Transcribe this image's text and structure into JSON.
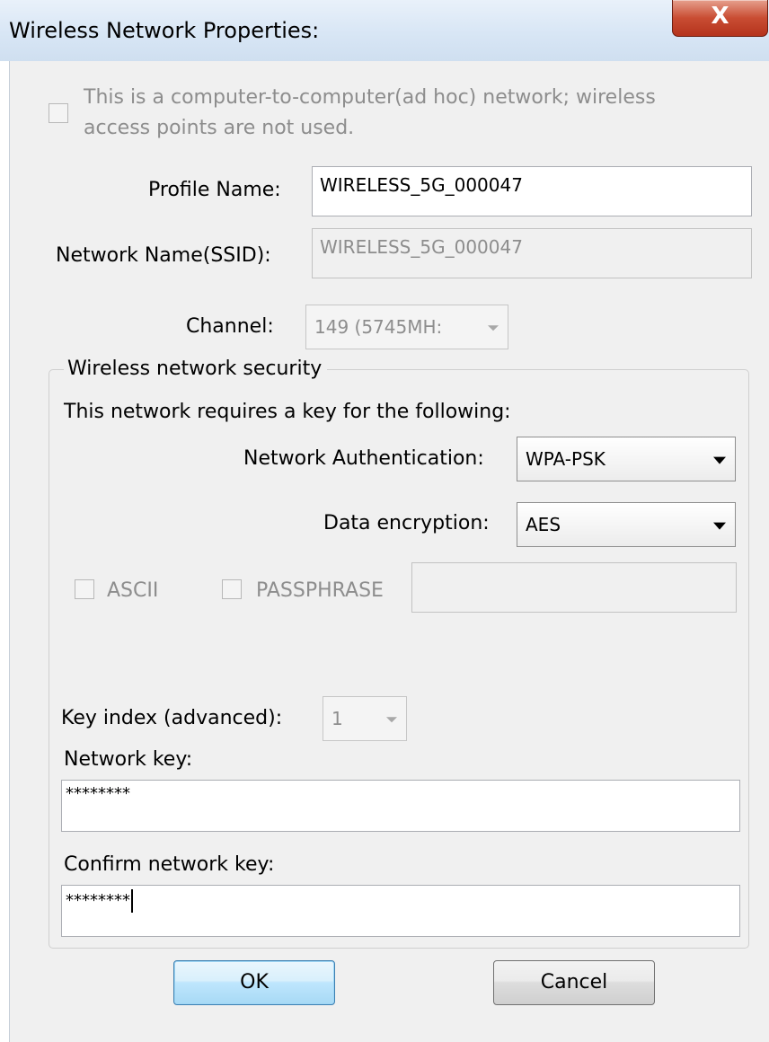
{
  "window": {
    "title": "Wireless Network Properties:",
    "close_glyph": "X"
  },
  "adhoc": {
    "label_line1": "This is a computer-to-computer(ad hoc) network; wireless",
    "label_line2": "access points are not used.",
    "checked": false
  },
  "profile_name": {
    "label": "Profile Name:",
    "value": "WIRELESS_5G_000047"
  },
  "ssid": {
    "label": "Network Name(SSID):",
    "value": "WIRELESS_5G_000047"
  },
  "channel": {
    "label": "Channel:",
    "value": "149 (5745MH:"
  },
  "security": {
    "group_label": "Wireless network security",
    "requires_key_text": "This network requires a key for the following:",
    "auth_label": "Network Authentication:",
    "auth_value": "WPA-PSK",
    "encryption_label": "Data encryption:",
    "encryption_value": "AES",
    "ascii_label": "ASCII",
    "passphrase_label": "PASSPHRASE",
    "passphrase_value": "",
    "key_index_label": "Key index (advanced):",
    "key_index_value": "1",
    "network_key_label": "Network key:",
    "network_key_value": "********",
    "confirm_key_label": "Confirm network key:",
    "confirm_key_value": "********"
  },
  "buttons": {
    "ok": "OK",
    "cancel": "Cancel"
  },
  "icons": {
    "close": "close-icon",
    "dropdown": "chevron-down-icon"
  },
  "colors": {
    "ok_border": "#3c7fb1",
    "close_red": "#c94d33",
    "disabled_text": "#8d8d8d"
  }
}
